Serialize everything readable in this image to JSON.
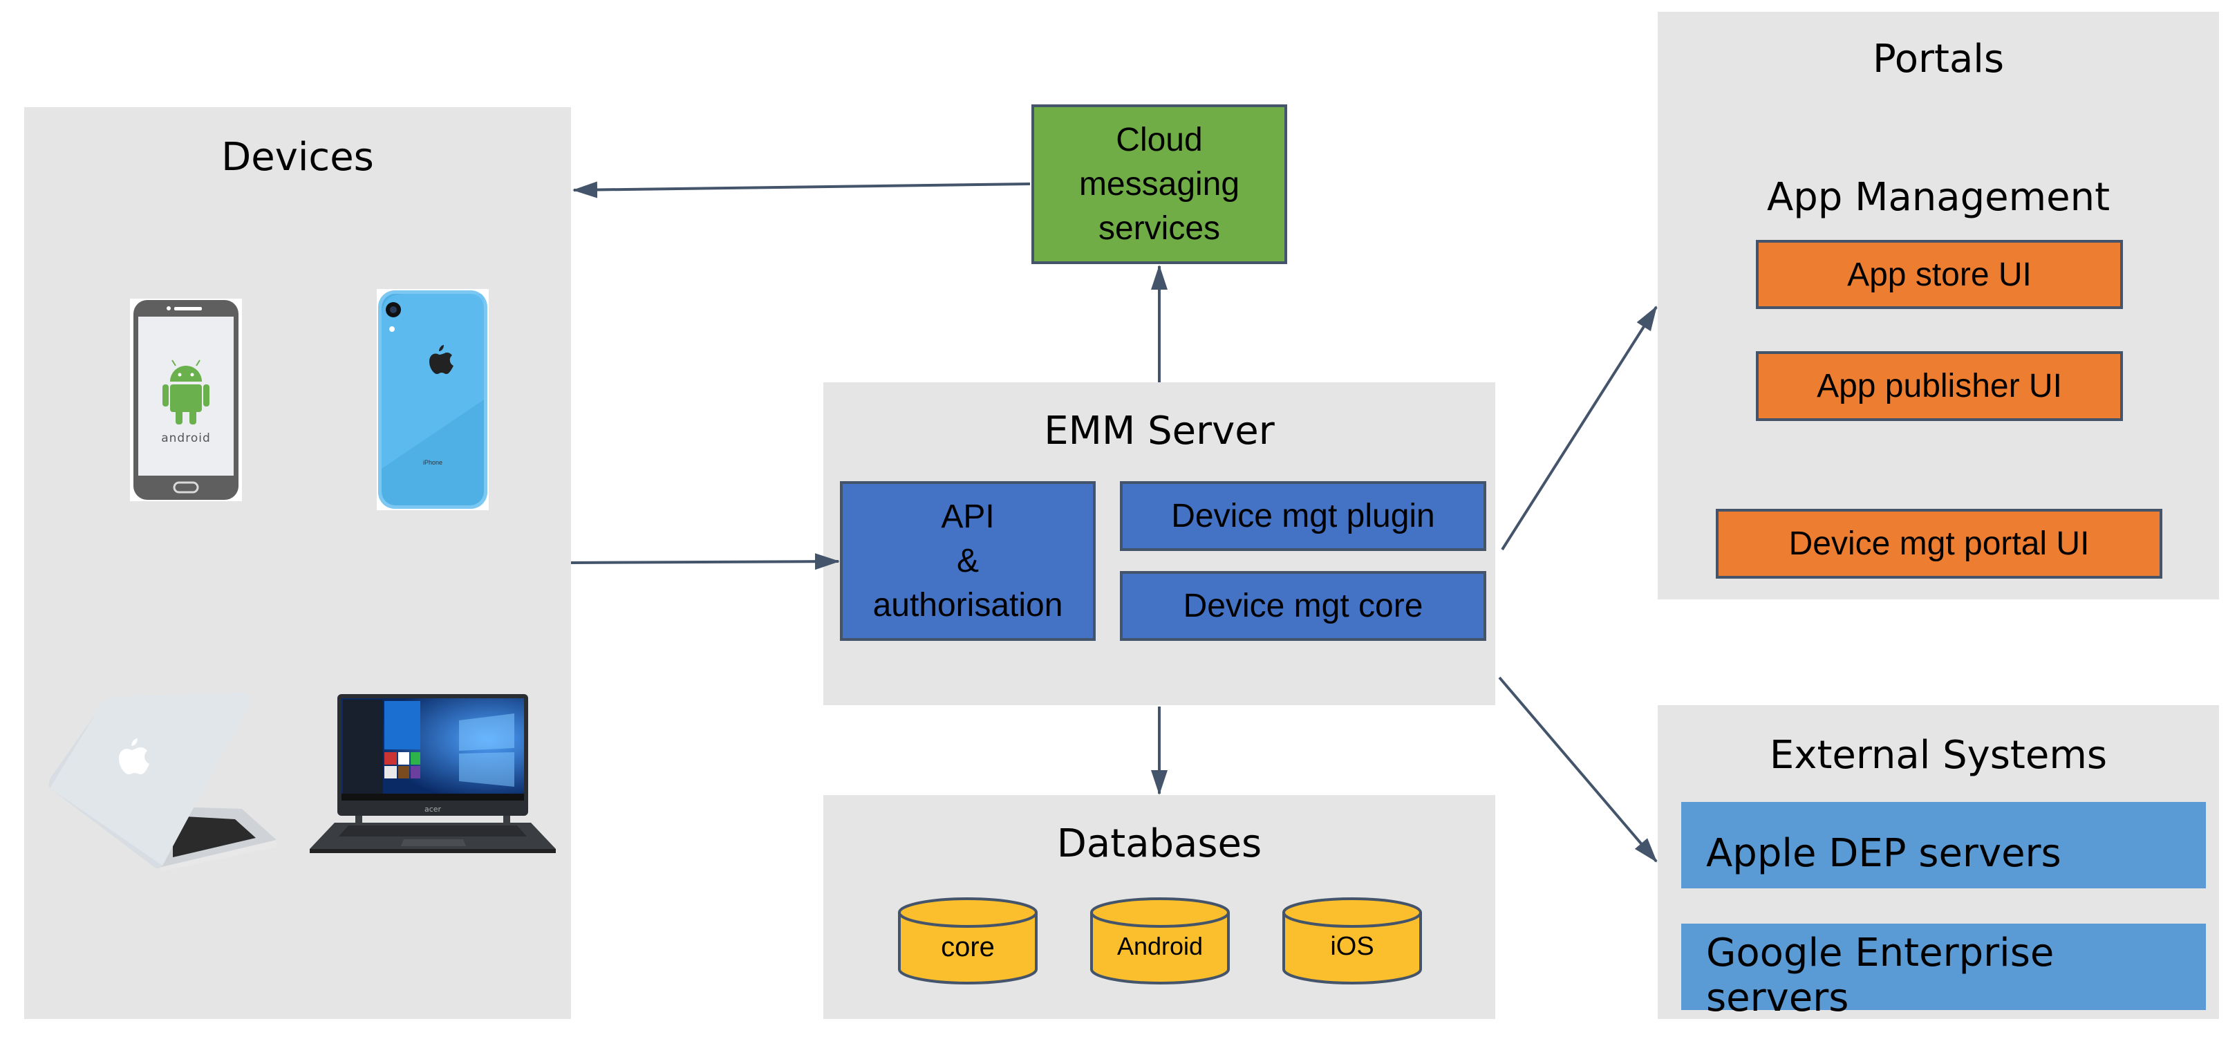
{
  "diagram": {
    "devices": {
      "title": "Devices",
      "items": [
        {
          "name": "Android phone",
          "label": "android"
        },
        {
          "name": "iPhone",
          "label": "iPhone"
        },
        {
          "name": "MacBook laptop",
          "label": ""
        },
        {
          "name": "Acer Windows laptop",
          "label": "acer"
        }
      ]
    },
    "cloud": {
      "label": "Cloud messaging services",
      "lines": [
        "Cloud",
        "messaging",
        "services"
      ]
    },
    "emm_server": {
      "title": "EMM Server",
      "api_lines": [
        "API",
        "&",
        "authorisation"
      ],
      "plugin": "Device mgt plugin",
      "core": "Device mgt core"
    },
    "databases": {
      "title": "Databases",
      "items": [
        "core",
        "Android",
        "iOS"
      ]
    },
    "portals": {
      "title": "Portals",
      "app_management": "App Management",
      "app_store": "App store UI",
      "app_publisher": "App publisher UI",
      "device_portal": "Device mgt portal UI"
    },
    "external": {
      "title": "External Systems",
      "apple": "Apple DEP servers",
      "google": "Google Enterprise servers"
    },
    "colors": {
      "panel": "#e5e5e5",
      "cloud": "#70ad47",
      "emm": "#4472c4",
      "portal": "#ed7d31",
      "external": "#5b9bd5",
      "database": "#fbbf2d",
      "arrow": "#44546a"
    },
    "connections": [
      {
        "from": "Cloud messaging services",
        "to": "Devices"
      },
      {
        "from": "EMM Server",
        "to": "Cloud messaging services"
      },
      {
        "from": "Devices",
        "to": "API & authorisation"
      },
      {
        "from": "EMM Server",
        "to": "Databases"
      },
      {
        "from": "EMM Server",
        "to": "Portals"
      },
      {
        "from": "EMM Server",
        "to": "External Systems"
      }
    ]
  }
}
